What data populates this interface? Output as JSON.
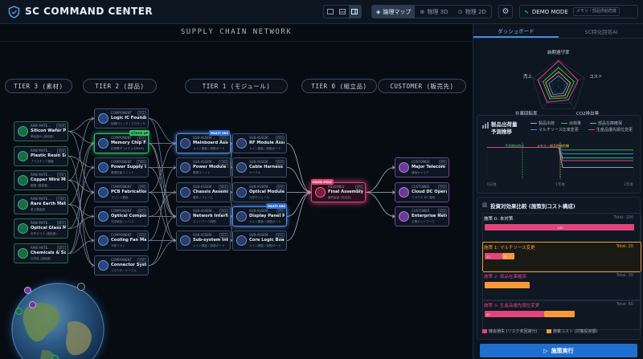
{
  "header": {
    "title": "SC COMMAND CENTER",
    "version": "V1.1.2",
    "view_modes": [
      {
        "label": "論理マップ",
        "icon": "layers-icon",
        "active": true
      },
      {
        "label": "物理 3D",
        "icon": "globe-icon",
        "active": false
      },
      {
        "label": "物理 2D",
        "icon": "map-pin-icon",
        "active": false
      }
    ],
    "demo_label": "DEMO MODE",
    "demo_select_placeholder": "メモリ・部品供給危機"
  },
  "network": {
    "title": "SUPPLY CHAIN NETWORK",
    "tiers": [
      "TIER 3 (素材)",
      "TIER 2 (部品)",
      "TIER 1 (モジュール)",
      "TIER 0 (組立品)",
      "CUSTOMER (販売先)"
    ],
    "nodes": {
      "raw": [
        {
          "type": "RAW MATE...",
          "country": "NOR",
          "name": "Silicon Wafer Pla...",
          "sub": "単結晶Si (高純度)"
        },
        {
          "type": "RAW MATE...",
          "country": "USA",
          "name": "Plastic Resin Sup...",
          "sub": "プラスチック樹脂"
        },
        {
          "type": "RAW MATE...",
          "country": "CHL",
          "name": "Copper Wire Mill...",
          "sub": "銅線 (高純度)"
        },
        {
          "type": "RAW MATE...",
          "country": "CHN",
          "name": "Rare Earth Metal...",
          "sub": "希土類金属"
        },
        {
          "type": "RAW MATE...",
          "country": "DEU",
          "name": "Optical Glass Ma...",
          "sub": "光学ガラス (高純度)"
        },
        {
          "type": "RAW MATE...",
          "country": "DEU",
          "name": "Chemicals & Sol...",
          "sub": "化学品 (高純度)"
        }
      ],
      "comp": [
        {
          "type": "COMPONENT",
          "country": "USA",
          "name": "Logic IC Foundry...",
          "sub": "制御ロジック / プロセッサ"
        },
        {
          "type": "COMPONENT",
          "country": "KOR",
          "name": "Memory Chip Fa...",
          "sub": "記憶素子 (メモリ/DRAM)"
        },
        {
          "type": "COMPONENT",
          "country": "TWN",
          "name": "Power Supply Un...",
          "sub": "電源供給ユニット"
        },
        {
          "type": "COMPONENT",
          "country": "JPN",
          "name": "PCB Fabrication...",
          "sub": "プリント基板"
        },
        {
          "type": "COMPONENT",
          "country": "DEU",
          "name": "Optical Compon...",
          "sub": "光学部品 / レンズ"
        },
        {
          "type": "COMPONENT",
          "country": "USA",
          "name": "Cooling Fan Ma...",
          "sub": "冷却ファン"
        },
        {
          "type": "COMPONENT",
          "country": "ESP",
          "name": "Connector Syste...",
          "sub": "コネクタ・ケーブル"
        }
      ],
      "sub_left": [
        {
          "type": "SUB-ASSEM...",
          "country": "USA",
          "name": "Mainboard Asse...",
          "sub": "メイン基板 / 制御ボード"
        },
        {
          "type": "SUB-ASSEM...",
          "country": "CHN",
          "name": "Power Module In...",
          "sub": "電源ユニット"
        },
        {
          "type": "SUB-ASSEM...",
          "country": "MEX",
          "name": "Chassis Assembl...",
          "sub": "筐体 / フレーム"
        },
        {
          "type": "SUB-ASSEM...",
          "country": "USA",
          "name": "Network Interfac...",
          "sub": "ネットワーク制御"
        },
        {
          "type": "SUB-ASSEM...",
          "country": "USA",
          "name": "Sub-system Inte...",
          "sub": "メイン基板 / 制御ボード"
        }
      ],
      "sub_right": [
        {
          "type": "SUB-ASSEM...",
          "country": "USA",
          "name": "RF Module Asse...",
          "sub": "メイン基板 / 制御ボード"
        },
        {
          "type": "SUB-ASSEM...",
          "country": "KOR",
          "name": "Cable Harness In...",
          "sub": "ケーブル"
        },
        {
          "type": "SUB-ASSEM...",
          "country": "JPN",
          "name": "Optical Module ...",
          "sub": "光学モジュール"
        },
        {
          "type": "SUB-ASSEM...",
          "country": "JPN",
          "name": "Display Panel M...",
          "sub": "メイン基板 / 制御ボード"
        },
        {
          "type": "SUB-ASSEM...",
          "country": "USA",
          "name": "Core Logic Boar...",
          "sub": "メイン基板 / 制御ボード"
        }
      ],
      "assembly": {
        "type": "ASSEMBLY",
        "country": "JPN",
        "name": "Final Assembly ...",
        "sub": "最終製品 (完成品)"
      },
      "customers": [
        {
          "type": "CUSTOMER",
          "country": "JPN",
          "name": "Major Telecom C...",
          "sub": "通信キャリア"
        },
        {
          "type": "CUSTOMER",
          "country": "FRA",
          "name": "Cloud DC Operat...",
          "sub": "クラウド DC 運用"
        },
        {
          "type": "CUSTOMER",
          "country": "USA",
          "name": "Enterprise Netw...",
          "sub": "企業ネットワーク"
        }
      ]
    },
    "badges": {
      "stock_up": "STOCK UP",
      "multi_src_1": "MULTI SRC",
      "multi_src_2": "MULTI SRC",
      "prod_prio": "PROD PRIO"
    }
  },
  "panel": {
    "tabs": [
      {
        "label": "ダッシュボード",
        "active": true
      },
      {
        "label": "SC特化回答AI",
        "active": false
      }
    ],
    "radar_labels": [
      "納期遵守率",
      "コスト",
      "CO2排出量",
      "在庫回転率",
      "売上"
    ],
    "forecast": {
      "title_line1": "製品出荷量",
      "title_line2": "予測推移",
      "legend": [
        {
          "label": "製品出荷",
          "color": "#9fb0c4"
        },
        {
          "label": "出荷量",
          "color": "#35c060"
        },
        {
          "label": "部品在庫確保",
          "color": "#3fd0a0"
        },
        {
          "label": "マルチソース比率変更",
          "color": "#3f8fe0"
        },
        {
          "label": "生産品優先順位変更",
          "color": "#e0457a"
        }
      ],
      "annotations": [
        "予測開始時点",
        "メモリ・部品供給危機"
      ],
      "x_ticks": [
        "0日後",
        "1年後",
        "2年後"
      ],
      "chart_data": {
        "type": "line",
        "x": [
          "0日後",
          "1年後",
          "2年後"
        ],
        "series": [
          {
            "name": "製品出荷",
            "values": [
              100,
              100,
              62
            ]
          },
          {
            "name": "出荷量",
            "values": [
              100,
              100,
              95
            ]
          },
          {
            "name": "部品在庫確保",
            "values": [
              100,
              100,
              80
            ]
          },
          {
            "name": "マルチソース比率変更",
            "values": [
              100,
              100,
              88
            ]
          },
          {
            "name": "生産品優先順位変更",
            "values": [
              100,
              100,
              75
            ]
          }
        ]
      }
    },
    "scenario": {
      "title": "投資対効果比較 (施策別コスト構成)",
      "items": [
        {
          "label": "施策 0: 未対策",
          "total": "Total: 100",
          "segments": [
            {
              "value": 100,
              "label": "100",
              "color": "#e0457a"
            }
          ],
          "color": "#dfe7f2"
        },
        {
          "label": "施策 1: マルチソース変更",
          "total": "Total: 20",
          "segments": [
            {
              "value": 12,
              "label": "12",
              "color": "#e0457a"
            },
            {
              "value": 8,
              "label": "8",
              "color": "#f59a3a"
            }
          ],
          "color": "#f59a3a"
        },
        {
          "label": "施策 2: 部品在庫確保",
          "total": "Total: 30",
          "segments": [
            {
              "value": 30,
              "label": "",
              "color": "#f59a3a"
            }
          ],
          "color": "#e0457a"
        },
        {
          "label": "施策 3: 生産品優先順位変更",
          "total": "Total: 60",
          "segments": [
            {
              "value": 40,
              "label": "40",
              "color": "#e0457a"
            },
            {
              "value": 20,
              "label": "",
              "color": "#f59a3a"
            }
          ],
          "color": "#e0457a"
        }
      ],
      "legend": [
        {
          "label": "機会損失 (リスク未回避分)",
          "color": "#e0457a"
        },
        {
          "label": "施策コスト (対策投資額)",
          "color": "#f59a3a"
        }
      ]
    },
    "execute_label": "施策実行"
  }
}
